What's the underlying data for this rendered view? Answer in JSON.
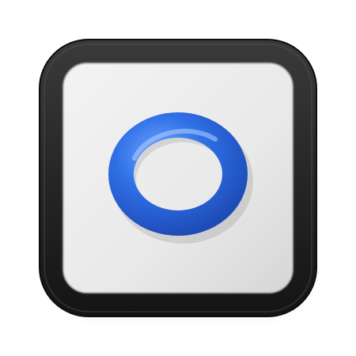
{
  "icon": {
    "name": "circle-badge-icon",
    "frame_color": "#2b2b2b",
    "panel_color": "#e7e7e7",
    "ring_color": "#2f6fe6"
  }
}
